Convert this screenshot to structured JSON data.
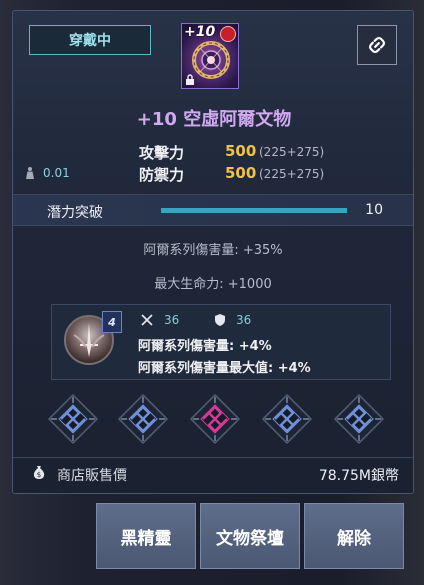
{
  "status": {
    "equipped_label": "穿戴中"
  },
  "item": {
    "enhance_badge": "+10",
    "title": "+10 空虛阿爾文物"
  },
  "stats": {
    "weight": "0.01",
    "attack": {
      "label": "攻擊力",
      "value": "500",
      "breakdown": "(225+275)"
    },
    "defense": {
      "label": "防禦力",
      "value": "500",
      "breakdown": "(225+275)"
    }
  },
  "potential": {
    "label": "潛力突破",
    "value": "10",
    "fill_fraction": 1.0
  },
  "bonuses": [
    "阿爾系列傷害量: +35%",
    "最大生命力: +1000"
  ],
  "rune": {
    "level": "4",
    "attack_stat": "36",
    "defense_stat": "36",
    "effects": [
      "阿爾系列傷害量: +4%",
      "阿爾系列傷害量最大值: +4%"
    ]
  },
  "slots": [
    {
      "icon": "rune-slot-icon",
      "color": "#6f8fd6"
    },
    {
      "icon": "rune-slot-icon",
      "color": "#6f8fd6"
    },
    {
      "icon": "rune-slot-icon",
      "color": "#d23a9a"
    },
    {
      "icon": "rune-slot-icon",
      "color": "#6f8fd6"
    },
    {
      "icon": "rune-slot-icon",
      "color": "#6f8fd6"
    }
  ],
  "sell": {
    "label": "商店販售價",
    "value": "78.75M銀幣"
  },
  "buttons": {
    "black_spirit": "黑精靈",
    "artifact_altar": "文物祭壇",
    "unequip": "解除"
  },
  "colors": {
    "title_purple": "#d0a9f0",
    "value_gold": "#f2c247",
    "teal": "#5fb6c4"
  }
}
